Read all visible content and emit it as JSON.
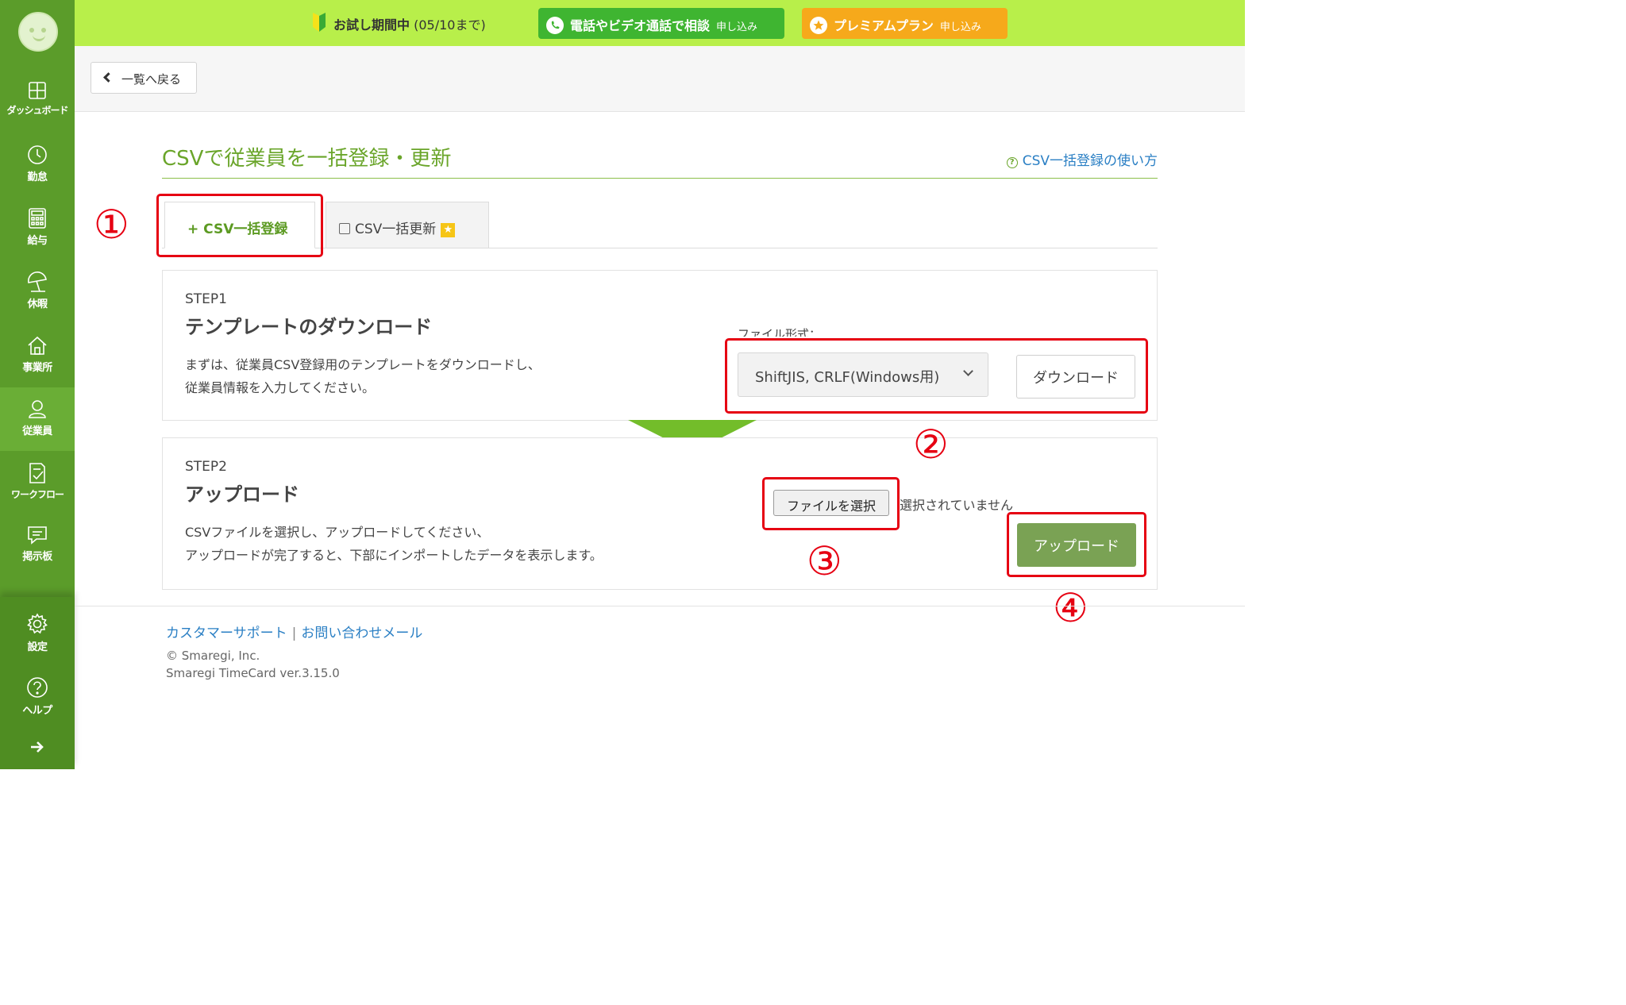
{
  "banner": {
    "trial_bold": "お試し期間中",
    "trial_period": "(05/10まで)",
    "call_label": "電話やビデオ通話で相談",
    "call_apply": "申し込み",
    "premium_label": "プレミアムプラン",
    "premium_apply": "申し込み"
  },
  "sidebar": {
    "items": [
      {
        "label": "ダッシュボード",
        "icon": "dashboard-icon"
      },
      {
        "label": "勤怠",
        "icon": "clock-icon"
      },
      {
        "label": "給与",
        "icon": "calculator-icon"
      },
      {
        "label": "休暇",
        "icon": "beach-umbrella-icon"
      },
      {
        "label": "事業所",
        "icon": "home-icon"
      },
      {
        "label": "従業員",
        "icon": "person-icon"
      },
      {
        "label": "ワークフロー",
        "icon": "workflow-icon"
      },
      {
        "label": "掲示板",
        "icon": "message-board-icon"
      },
      {
        "label": "設定",
        "icon": "gear-icon"
      },
      {
        "label": "ヘルプ",
        "icon": "help-icon"
      }
    ],
    "active": "従業員"
  },
  "back": {
    "label": "一覧へ戻る"
  },
  "page": {
    "title": "CSVで従業員を一括登録・更新",
    "howto_link": "CSV一括登録の使い方"
  },
  "tabs": [
    {
      "label": "CSV一括登録",
      "prefix": "+"
    },
    {
      "label": "CSV一括更新"
    }
  ],
  "step1": {
    "step": "STEP1",
    "heading": "テンプレートのダウンロード",
    "desc_line1": "まずは、従業員CSV登録用のテンプレートをダウンロードし、",
    "desc_line2": "従業員情報を入力してください。",
    "format_label": "ファイル形式：",
    "format_selected": "ShiftJIS, CRLF(Windows用)",
    "download_label": "ダウンロード"
  },
  "step2": {
    "step": "STEP2",
    "heading": "アップロード",
    "desc_line1": "CSVファイルを選択し、アップロードしてください、",
    "desc_line2": "アップロードが完了すると、下部にインポートしたデータを表示します。",
    "choose_file": "ファイルを選択",
    "file_status": "選択されていません",
    "upload_label": "アップロード"
  },
  "annotations": [
    "①",
    "②",
    "③",
    "④"
  ],
  "footer": {
    "support": "カスタマーサポート",
    "separator": "|",
    "mail": "お問い合わせメール",
    "copyright": "© Smaregi, Inc.",
    "version": "Smaregi TimeCard ver.3.15.0"
  },
  "colors": {
    "sidebar": "#5b9c2a",
    "banner": "#b8ef4a",
    "accent_green": "#6aa52a",
    "annotation_red": "#e60012",
    "upload_button": "#7aa254"
  }
}
